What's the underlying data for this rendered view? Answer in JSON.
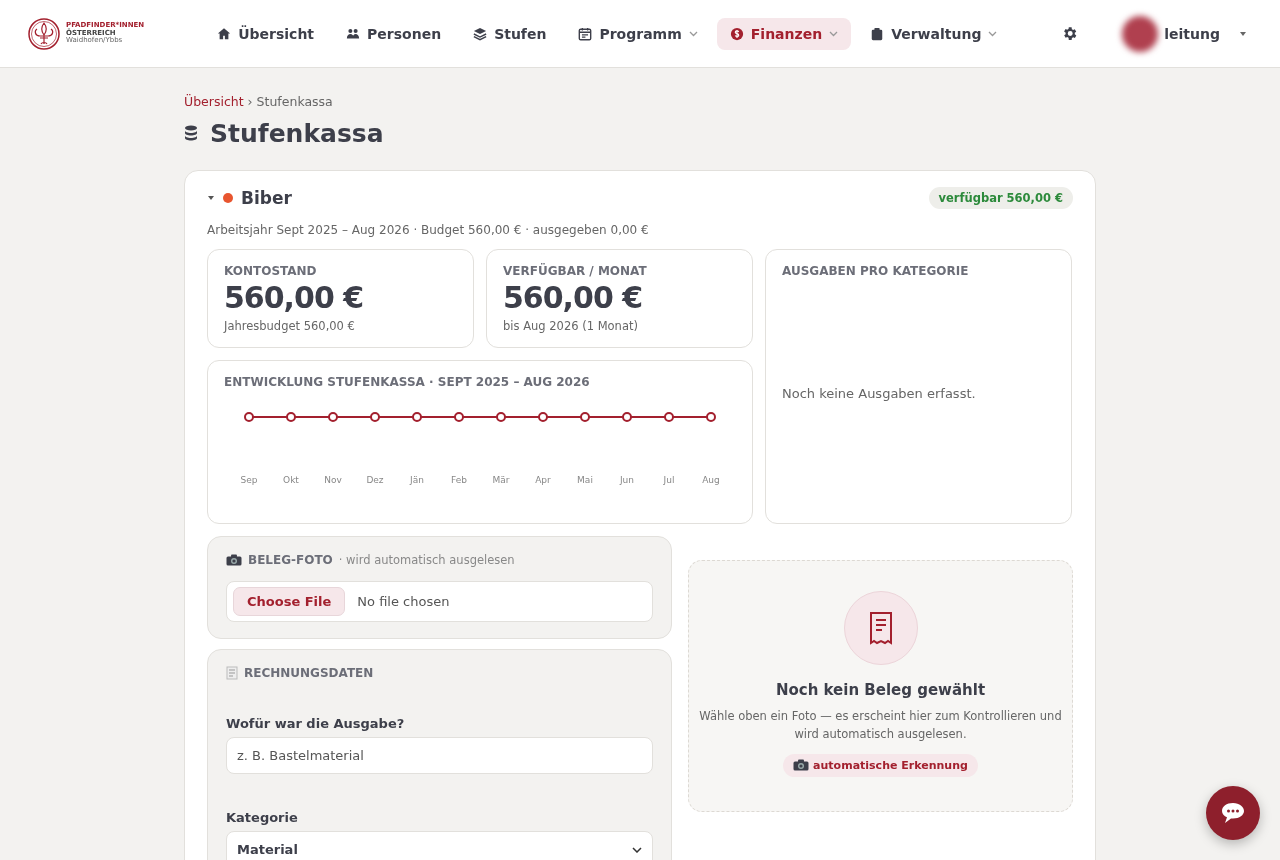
{
  "logo": {
    "line_1": "PFADFINDER*INNEN",
    "line_2": "ÖSTERREICH",
    "line_3": "Waidhofen/Ybbs"
  },
  "nav": [
    {
      "label": "Übersicht",
      "dropdown": false,
      "selected": false
    },
    {
      "label": "Personen",
      "dropdown": false,
      "selected": false
    },
    {
      "label": "Stufen",
      "dropdown": false,
      "selected": false
    },
    {
      "label": "Programm",
      "dropdown": true,
      "selected": false
    },
    {
      "label": "Finanzen",
      "dropdown": true,
      "selected": true
    },
    {
      "label": "Verwaltung",
      "dropdown": true,
      "selected": false
    }
  ],
  "user": {
    "name": "leitung"
  },
  "breadcrumb": [
    {
      "label": "Übersicht",
      "kind": "link"
    },
    {
      "label": "›",
      "kind": "separator"
    },
    {
      "label": "Stufenkassa",
      "kind": "current"
    }
  ],
  "page_title": "Stufenkassa",
  "group": {
    "name": "Biber",
    "color": "#e8552f",
    "expanded": true,
    "badge": "verfügbar 560,00 €",
    "summary": "Arbeitsjahr Sept 2025 – Aug 2026 · Budget 560,00 € · ausgegeben 0,00 €"
  },
  "stats": [
    {
      "label": "KONTOSTAND",
      "value": "560,00 €",
      "note": "Jahresbudget 560,00 €"
    },
    {
      "label": "VERFÜGBAR / MONAT",
      "value": "560,00 €",
      "note": "bis Aug 2026 (1 Monat)"
    }
  ],
  "categories_panel": {
    "title": "AUSGABEN PRO KATEGORIE",
    "empty_text": "Noch keine Ausgaben erfasst."
  },
  "development": {
    "title": "ENTWICKLUNG STUFENKASSA · SEPT 2025 – AUG 2026",
    "months": [
      "Sep",
      "Okt",
      "Nov",
      "Dez",
      "Jän",
      "Feb",
      "Mär",
      "Apr",
      "Mai",
      "Jun",
      "Jul",
      "Aug"
    ]
  },
  "receipt_photo": {
    "title": "BELEG-FOTO",
    "hint": "· wird automatisch ausgelesen",
    "button": "Choose File",
    "status": "No file chosen"
  },
  "invoice": {
    "title": "RECHNUNGSDATEN",
    "fields": [
      {
        "label": "Wofür war die Ausgabe?",
        "kind": "text",
        "placeholder": "z. B. Bastelmaterial"
      },
      {
        "label": "Kategorie",
        "kind": "select",
        "value": "Material"
      }
    ]
  },
  "preview": {
    "title": "Noch kein Beleg gewählt",
    "text": "Wähle oben ein Foto — es erscheint hier zum Kontrollieren und wird automatisch ausgelesen.",
    "badge": "automatische Erkennung"
  }
}
